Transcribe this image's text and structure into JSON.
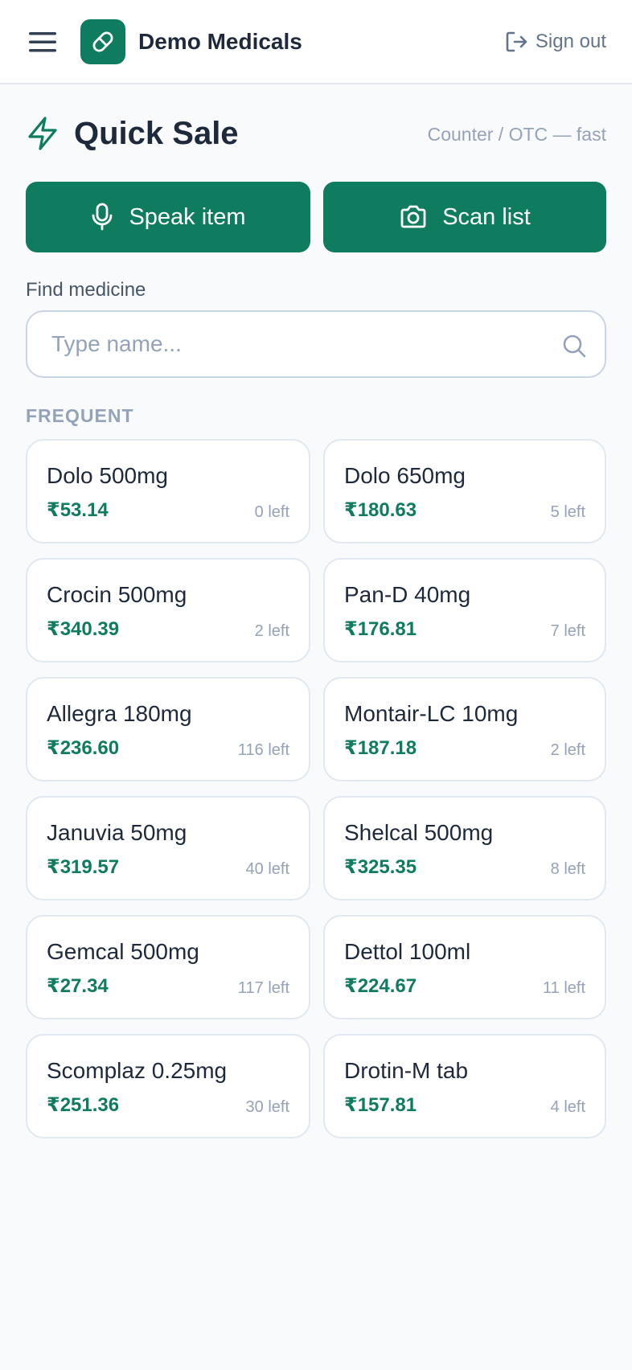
{
  "header": {
    "brand": "Demo Medicals",
    "signout_label": "Sign out",
    "icons": {
      "menu": "hamburger-menu-icon",
      "logo": "pill-icon",
      "signout": "sign-out-icon"
    }
  },
  "page": {
    "title": "Quick Sale",
    "subtitle": "Counter / OTC — fast",
    "title_icon": "lightning-bolt-icon"
  },
  "actions": {
    "speak_label": "Speak item",
    "scan_label": "Scan list"
  },
  "search": {
    "label": "Find medicine",
    "placeholder": "Type name...",
    "value": ""
  },
  "frequent": {
    "heading": "FREQUENT",
    "items": [
      {
        "name": "Dolo 500mg",
        "price": "₹53.14",
        "stock": "0 left"
      },
      {
        "name": "Dolo 650mg",
        "price": "₹180.63",
        "stock": "5 left"
      },
      {
        "name": "Crocin 500mg",
        "price": "₹340.39",
        "stock": "2 left"
      },
      {
        "name": "Pan-D 40mg",
        "price": "₹176.81",
        "stock": "7 left"
      },
      {
        "name": "Allegra 180mg",
        "price": "₹236.60",
        "stock": "116 left"
      },
      {
        "name": "Montair-LC 10mg",
        "price": "₹187.18",
        "stock": "2 left"
      },
      {
        "name": "Januvia 50mg",
        "price": "₹319.57",
        "stock": "40 left"
      },
      {
        "name": "Shelcal 500mg",
        "price": "₹325.35",
        "stock": "8 left"
      },
      {
        "name": "Gemcal 500mg",
        "price": "₹27.34",
        "stock": "117 left"
      },
      {
        "name": "Dettol 100ml",
        "price": "₹224.67",
        "stock": "11 left"
      },
      {
        "name": "Scomplaz 0.25mg",
        "price": "₹251.36",
        "stock": "30 left"
      },
      {
        "name": "Drotin-M tab",
        "price": "₹157.81",
        "stock": "4 left"
      }
    ]
  },
  "colors": {
    "accent": "#0f7b5f",
    "text": "#1e293b",
    "muted": "#94a3b8",
    "background": "#f8fafc"
  }
}
